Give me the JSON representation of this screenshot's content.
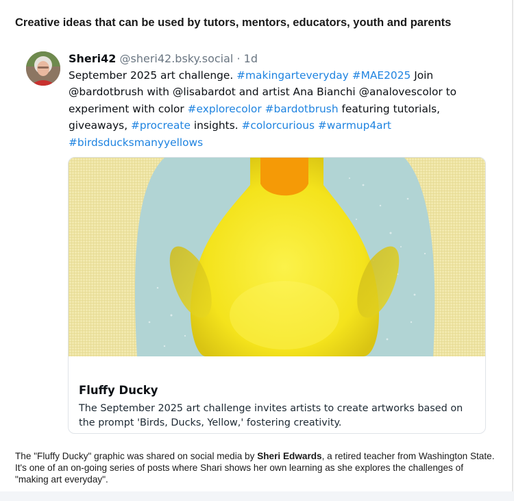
{
  "page": {
    "title": "Creative ideas that can be used by tutors, mentors, educators, youth and parents"
  },
  "post": {
    "author": "Sheri42",
    "handle": "@sheri42.bsky.social",
    "separator": "·",
    "age": "1d",
    "text": [
      {
        "t": "September 2025 art challenge. "
      },
      {
        "t": "#makingarteveryday",
        "tag": true
      },
      {
        "t": " "
      },
      {
        "t": "#MAE2025",
        "tag": true
      },
      {
        "t": " Join @bardotbrush with @lisabardot and artist Ana Bianchi @analovescolor to experiment with color "
      },
      {
        "t": "#explorecolor",
        "tag": true
      },
      {
        "t": " "
      },
      {
        "t": "#bardotbrush",
        "tag": true
      },
      {
        "t": " featuring tutorials, giveaways, "
      },
      {
        "t": "#procreate",
        "tag": true
      },
      {
        "t": " insights. "
      },
      {
        "t": "#colorcurious",
        "tag": true
      },
      {
        "t": " "
      },
      {
        "t": "#warmup4art",
        "tag": true
      },
      {
        "t": " "
      },
      {
        "t": "#birdsducksmanyyellows",
        "tag": true
      }
    ],
    "card": {
      "title": "Fluffy Ducky",
      "description": "The September 2025 art challenge invites artists to create artworks based on the prompt 'Birds, Ducks, Yellow,' fostering creativity."
    }
  },
  "caption": {
    "before": "The \"Fluffy Ducky\" graphic was shared on social media by ",
    "name": "Sheri Edwards",
    "after": ", a retired teacher from Washington State. It's one of an on-going series of posts where Shari shows her own learning as she explores the challenges of \"making art everyday\"."
  },
  "colors": {
    "hashtag": "#1e83e0",
    "cream_background": "#f2e9ae",
    "teal_background": "#b1d4d4",
    "duck_yellow": "#f6e823",
    "beak_orange": "#f59a06"
  }
}
